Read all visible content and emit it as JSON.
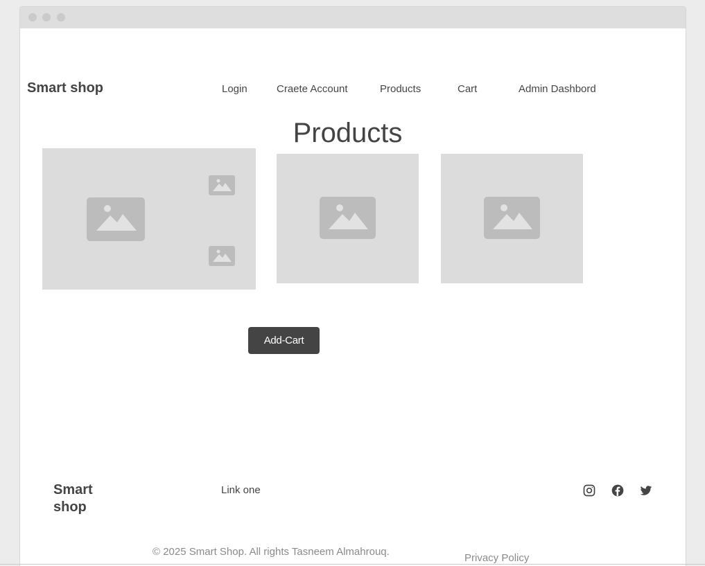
{
  "header": {
    "brand": "Smart shop",
    "nav": [
      {
        "label": "Login"
      },
      {
        "label": "Craete Account"
      },
      {
        "label": "Products"
      },
      {
        "label": "Cart"
      },
      {
        "label": "Admin Dashbord"
      }
    ]
  },
  "main": {
    "title": "Products",
    "add_cart_label": "Add-Cart",
    "images": [
      "image-placeholder-icon",
      "image-placeholder-icon",
      "image-placeholder-icon"
    ]
  },
  "footer": {
    "brand": "Smart shop",
    "link": "Link one",
    "social": [
      "instagram-icon",
      "facebook-icon",
      "twitter-icon"
    ],
    "copyright": "© 2025 Smart Shop. All rights Tasneem Almahrouq.",
    "privacy": "Privacy Policy"
  },
  "colors": {
    "background": "#ececec",
    "window": "#ffffff",
    "titlebar": "#dedede",
    "placeholder": "#dcdcdc",
    "placeholder_icon": "#bcbcbc",
    "button": "#444444",
    "text": "#444444",
    "muted_text": "#8a8a8a"
  }
}
